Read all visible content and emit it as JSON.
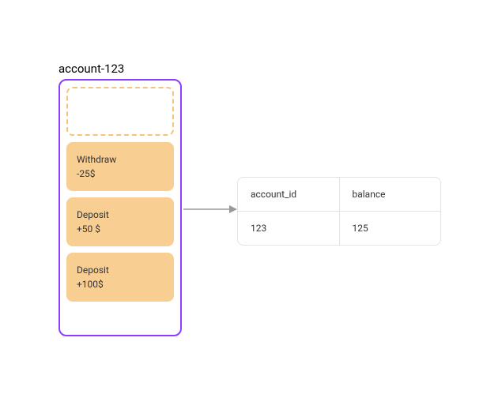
{
  "account": {
    "label": "account-123",
    "events": [
      {
        "title": "Withdraw",
        "amount": "-25$"
      },
      {
        "title": "Deposit",
        "amount": "+50 $"
      },
      {
        "title": "Deposit",
        "amount": "+100$"
      }
    ]
  },
  "table": {
    "headers": {
      "col1": "account_id",
      "col2": "balance"
    },
    "row": {
      "col1": "123",
      "col2": "125"
    }
  },
  "colors": {
    "container_border": "#8b3dff",
    "card_bg": "#f8ce92",
    "placeholder_border": "#f5c37d",
    "table_border": "#e3e3e3",
    "arrow": "#999999"
  }
}
